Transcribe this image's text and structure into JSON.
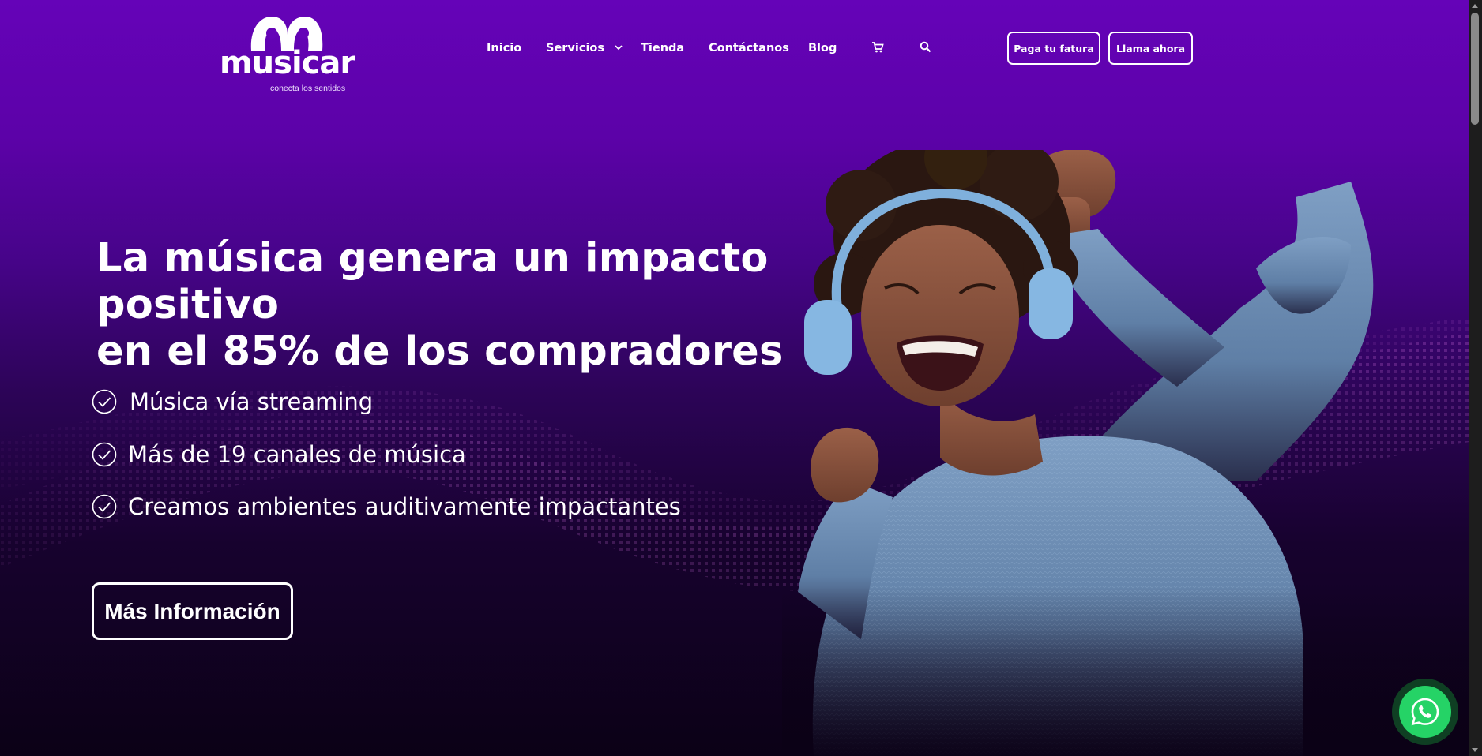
{
  "brand": {
    "name": "musicar",
    "tagline": "conecta los sentidos"
  },
  "nav": {
    "items": [
      {
        "label": "Inicio"
      },
      {
        "label": "Servicios",
        "has_dropdown": true
      },
      {
        "label": "Tienda"
      },
      {
        "label": "Contáctanos"
      },
      {
        "label": "Blog"
      }
    ],
    "cart_icon": "cart-icon",
    "search_icon": "search-icon"
  },
  "header_buttons": {
    "pay_invoice": "Paga tu fatura",
    "call_now": "Llama ahora"
  },
  "hero": {
    "headline_line1": "La música genera un impacto positivo",
    "headline_line2": "en el 85% de los compradores",
    "features": [
      "Música vía streaming",
      "Más de 19 canales de música",
      "Creamos ambientes auditivamente impactantes"
    ],
    "feature_icon": "check-circle-icon",
    "cta": "Más Información"
  },
  "floating": {
    "whatsapp_icon": "whatsapp-icon"
  },
  "colors": {
    "brand_purple": "#6503b8",
    "dark_bg": "#0b0116",
    "sweater_blue": "#7a9bbf",
    "whatsapp_green": "#25d366"
  }
}
